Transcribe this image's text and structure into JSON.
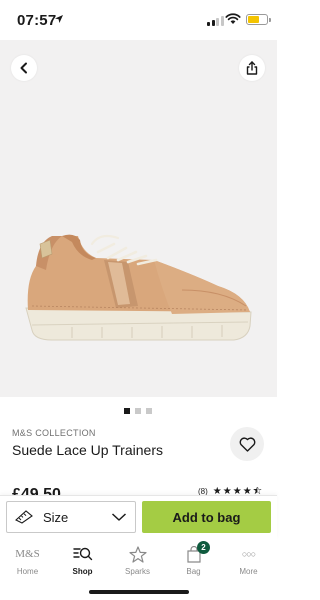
{
  "status_bar": {
    "time": "07:57"
  },
  "product": {
    "brand": "M&S COLLECTION",
    "title": "Suede Lace Up Trainers",
    "price": "£49.50",
    "review_count": "(8)",
    "rating": 4.5,
    "image_count": 3,
    "active_image_index": 0
  },
  "actions": {
    "size_label": "Size",
    "add_to_bag_label": "Add to bag"
  },
  "tabs": [
    {
      "label": "Home",
      "icon": "ms-logo-icon",
      "glyph": "M&S",
      "active": false
    },
    {
      "label": "Shop",
      "icon": "shop-search-icon",
      "active": true
    },
    {
      "label": "Sparks",
      "icon": "sparks-star-icon",
      "active": false
    },
    {
      "label": "Bag",
      "icon": "bag-icon",
      "active": false,
      "badge": "2"
    },
    {
      "label": "More",
      "icon": "more-dots-icon",
      "glyph": "○○○",
      "active": false
    }
  ],
  "colors": {
    "add_to_bag": "#a4cc44",
    "badge": "#0f5a3e",
    "hero_bg": "#f2f1f1"
  }
}
